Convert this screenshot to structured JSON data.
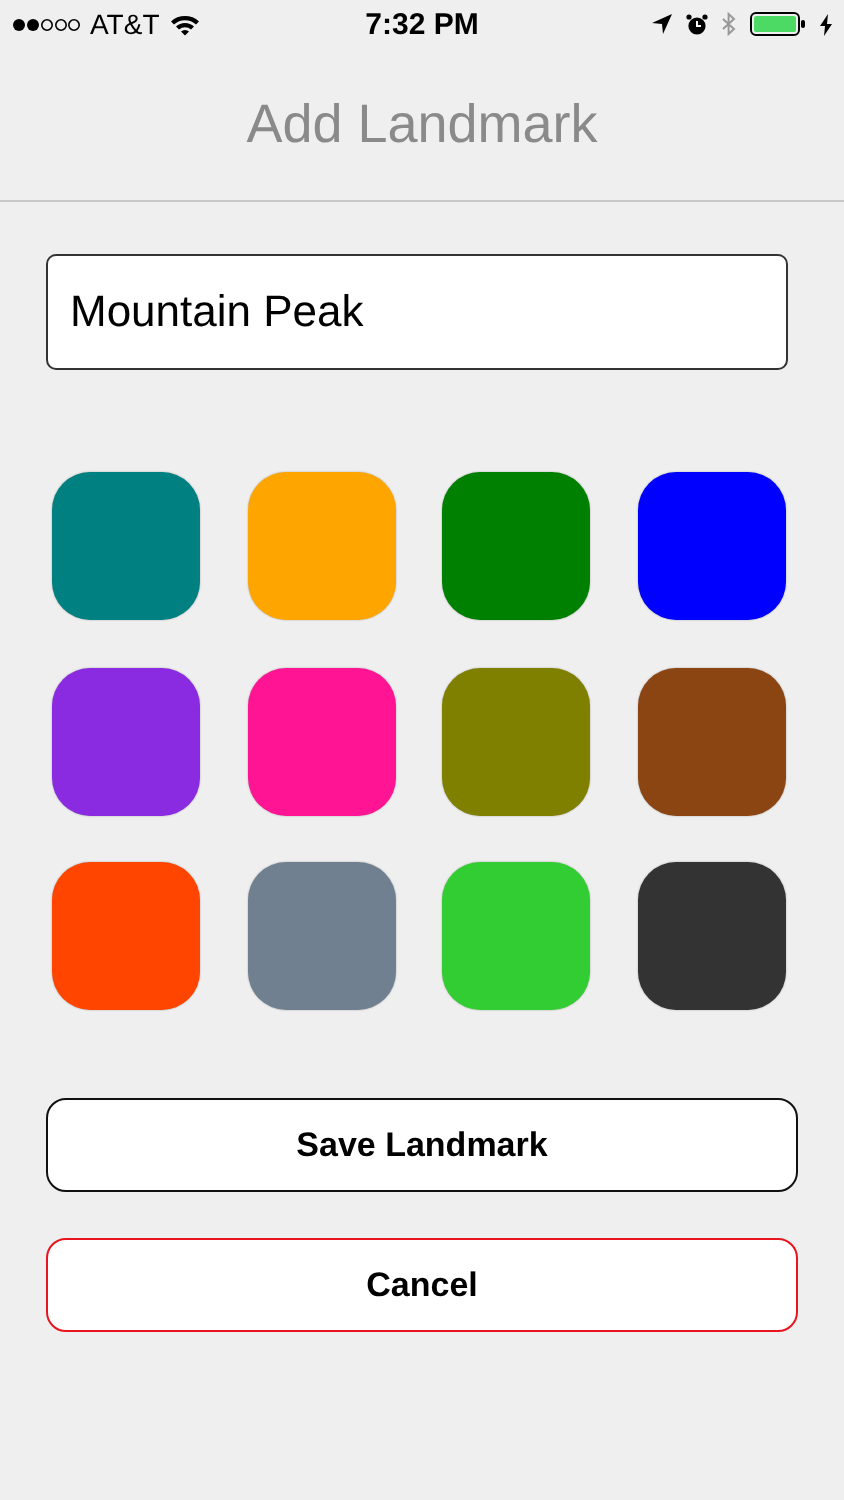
{
  "status_bar": {
    "carrier": "AT&T",
    "time": "7:32 PM"
  },
  "title": "Add Landmark",
  "name_field": {
    "value": "Mountain Peak"
  },
  "swatches": [
    {
      "color": "#008080"
    },
    {
      "color": "#ffa500"
    },
    {
      "color": "#008000"
    },
    {
      "color": "#0000ff"
    },
    {
      "color": "#8a2be2"
    },
    {
      "color": "#ff1493"
    },
    {
      "color": "#808000"
    },
    {
      "color": "#8b4513"
    },
    {
      "color": "#ff4500"
    },
    {
      "color": "#708090"
    },
    {
      "color": "#32cd32"
    },
    {
      "color": "#333333"
    }
  ],
  "buttons": [
    {
      "label": "Save Landmark",
      "kind": "primary"
    },
    {
      "label": "Cancel",
      "kind": "destructive"
    }
  ]
}
